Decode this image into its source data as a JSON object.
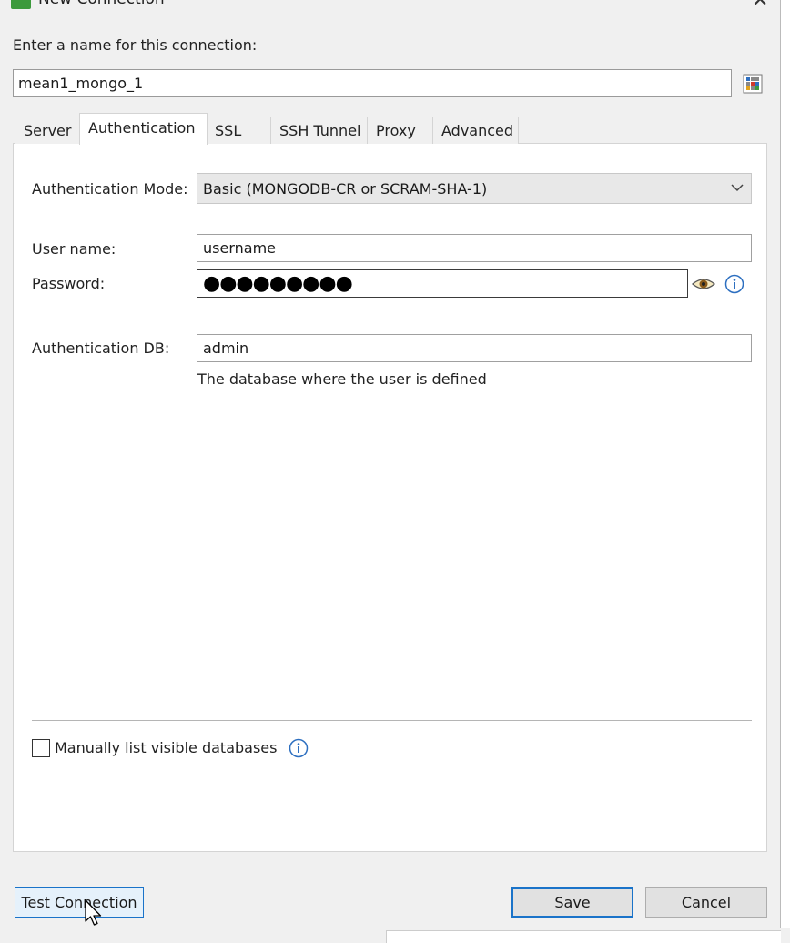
{
  "window": {
    "title": "New Connection"
  },
  "name_section": {
    "label": "Enter a name for this connection:",
    "value": "mean1_mongo_1"
  },
  "tabs": [
    {
      "label": "Server",
      "active": false
    },
    {
      "label": "Authentication",
      "active": true
    },
    {
      "label": "SSL",
      "active": false
    },
    {
      "label": "SSH Tunnel",
      "active": false
    },
    {
      "label": "Proxy",
      "active": false
    },
    {
      "label": "Advanced",
      "active": false
    }
  ],
  "auth": {
    "mode_label": "Authentication Mode:",
    "mode_value": "Basic (MONGODB-CR or SCRAM-SHA-1)",
    "username_label": "User name:",
    "username_value": "username",
    "password_label": "Password:",
    "password_mask": "●●●●●●●●●",
    "db_label": "Authentication DB:",
    "db_value": "admin",
    "db_hint": "The database where the user is defined",
    "manual_list_label": "Manually list visible databases",
    "manual_list_checked": false
  },
  "buttons": {
    "test": "Test Connection",
    "save": "Save",
    "cancel": "Cancel"
  },
  "icons": {
    "show_password": "eye-icon",
    "info": "info-icon",
    "grid": "grid-icon",
    "dropdown": "chevron-down-icon"
  },
  "colors": {
    "accent": "#1a73c9",
    "app_icon": "#3c9a3c"
  }
}
